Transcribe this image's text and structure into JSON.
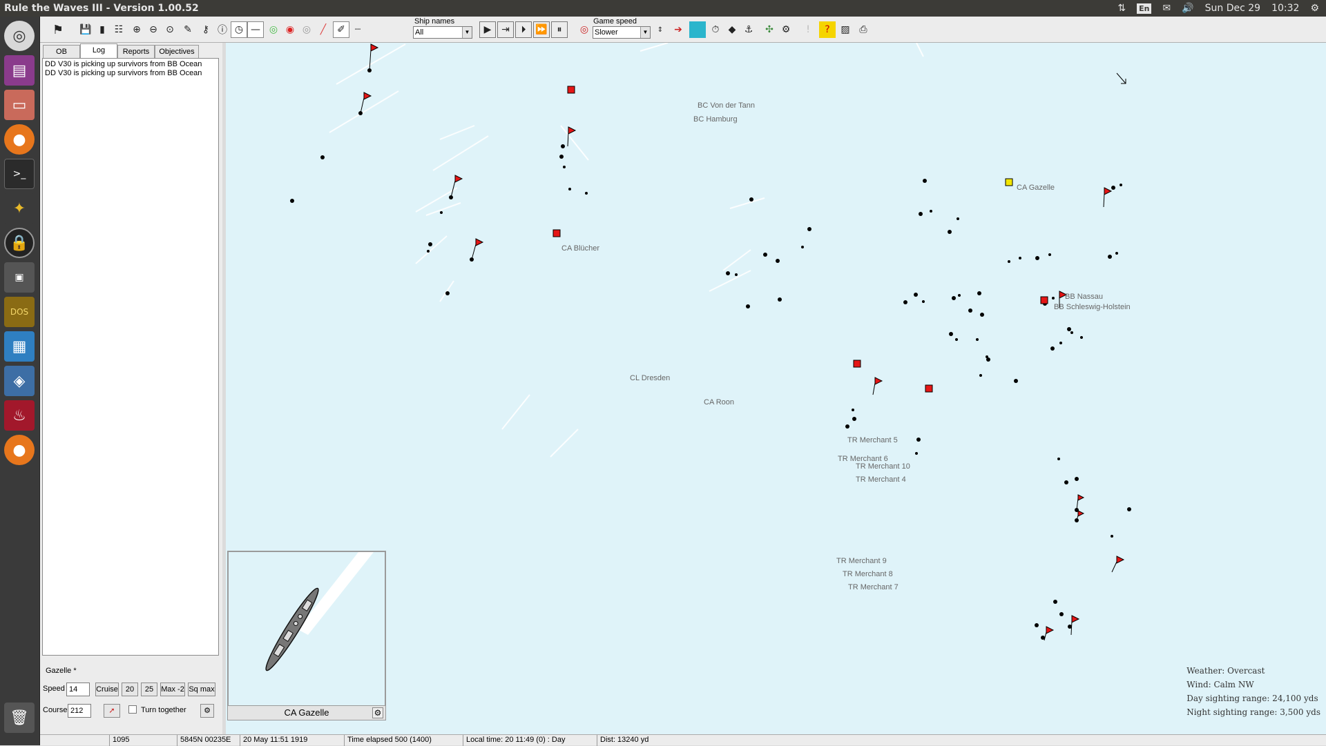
{
  "window": {
    "title": "Rule the Waves III - Version 1.00.52"
  },
  "system_tray": {
    "lang": "En",
    "date": "Sun Dec 29",
    "time": "10:32"
  },
  "launcher": {
    "items": [
      "chromium-icon",
      "calendar-icon",
      "files-icon",
      "firefox-icon",
      "terminal-icon",
      "piewm-icon",
      "lock-icon",
      "window-icon",
      "dosbox-icon",
      "writer-icon",
      "virtualbox-icon",
      "wine-icon",
      "firefox-alt-icon",
      "trash-icon"
    ]
  },
  "toolbar": {
    "ship_names_label": "Ship names",
    "ship_names_value": "All",
    "game_speed_label": "Game speed",
    "game_speed_value": "Slower"
  },
  "left_panel": {
    "tabs": [
      "OB",
      "Log",
      "Reports",
      "Objectives"
    ],
    "active_tab": "Log",
    "log_lines": [
      "DD V30 is picking up survivors from BB Ocean",
      "DD V30 is picking up survivors from BB Ocean"
    ],
    "selected_ship": "Gazelle *",
    "speed_label": "Speed",
    "speed_value": "14",
    "cruise_label": "Cruise",
    "speed_20": "20",
    "speed_25": "25",
    "max_label": "Max -2",
    "sq_max_label": "Sq max",
    "course_label": "Course",
    "course_value": "212",
    "turn_together_label": "Turn together"
  },
  "minimap": {
    "label": "CA Gazelle"
  },
  "map": {
    "ship_labels": [
      "BC Von der Tann",
      "BC Hamburg",
      "CA Gazelle",
      "CA Blücher",
      "BB Nassau",
      "BB Schleswig-Holstein",
      "CL Dresden",
      "CA Roon",
      "TR Merchant 5",
      "TR Merchant 6",
      "TR Merchant 10",
      "TR Merchant 4",
      "TR Merchant 9",
      "TR Merchant 8",
      "TR Merchant 7"
    ]
  },
  "weather": {
    "weather": "Weather: Overcast",
    "wind": "Wind: Calm  NW",
    "day_range": "Day sighting range: 24,100 yds",
    "night_range": "Night sighting range: 3,500 yds"
  },
  "status_bar": {
    "field1": "1095",
    "field2": "5845N 00235E",
    "field3": "20 May 11:51 1919",
    "field4": "Time elapsed 500 (1400)",
    "field5": "Local time: 20 11:49 (0) : Day",
    "field6": "Dist: 13240 yd"
  },
  "colors": {
    "sea": "#dff3f9",
    "flag_red": "#e51616",
    "flag_yellow": "#f2e600"
  }
}
